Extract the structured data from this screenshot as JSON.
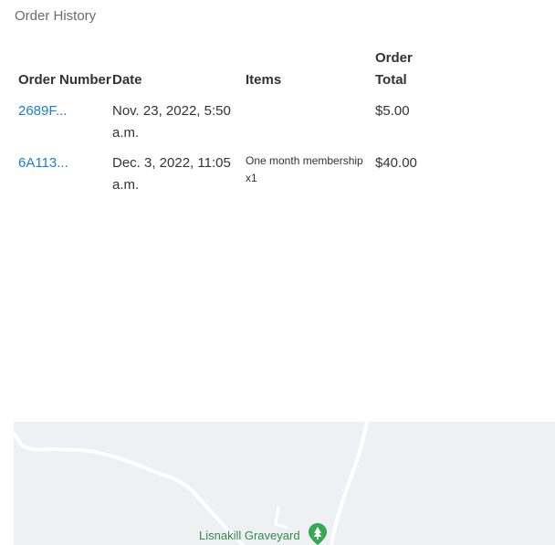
{
  "section": {
    "title": "Order History"
  },
  "table": {
    "headers": {
      "order_number": "Order Number",
      "date": "Date",
      "items": "Items",
      "order_total": "Order Total"
    },
    "rows": [
      {
        "order_number": "2689F...",
        "date": "Nov. 23, 2022, 5:50 a.m.",
        "items": "",
        "order_total": "$5.00"
      },
      {
        "order_number": "6A113...",
        "date": "Dec. 3, 2022, 11:05 a.m.",
        "items": "One month membership x1",
        "order_total": "$40.00"
      }
    ]
  },
  "map": {
    "place_label": "Lisnakill Graveyard",
    "pin_icon": "tree-pin-icon",
    "colors": {
      "background": "#eef0f3",
      "road": "#ffffff",
      "label": "#2f8c4b"
    }
  }
}
